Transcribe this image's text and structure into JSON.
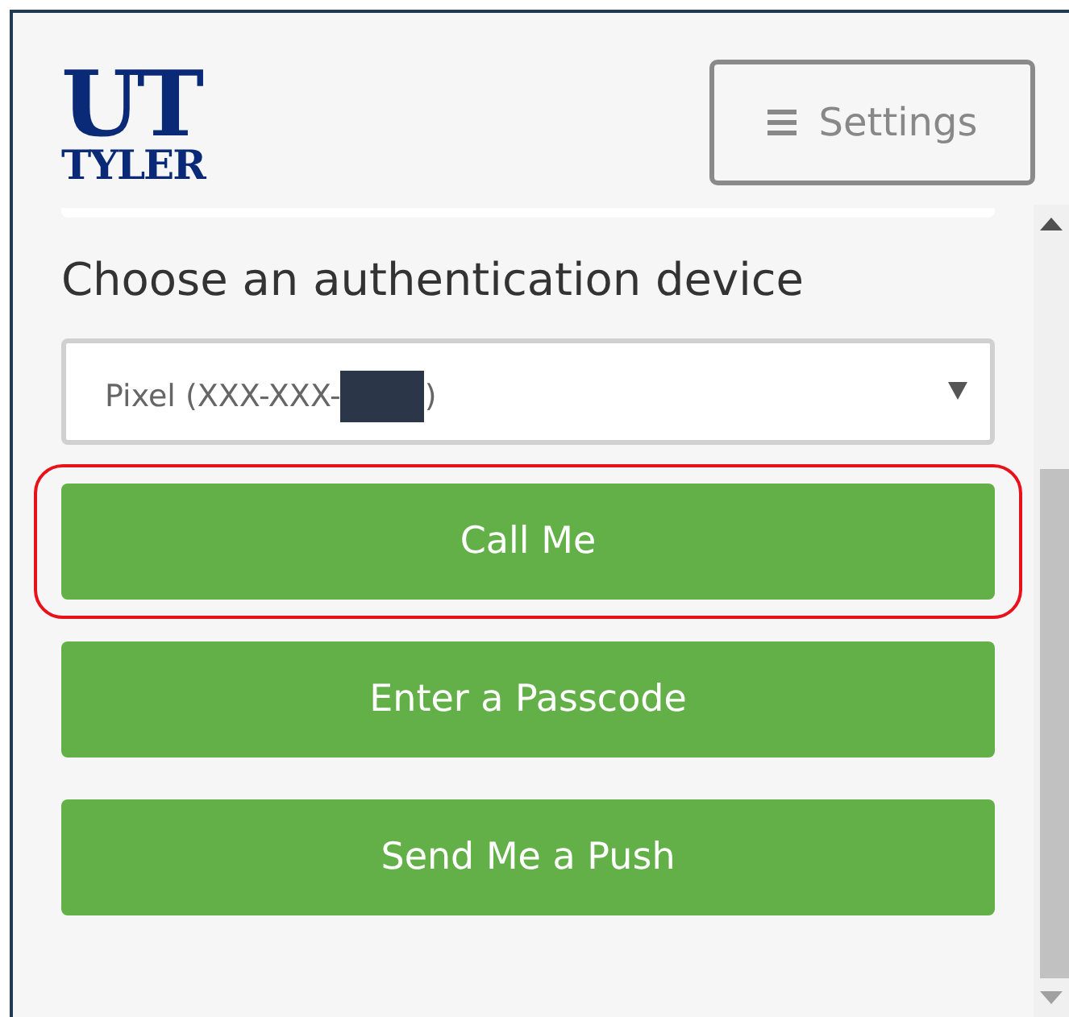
{
  "logo": {
    "line_1": "UT",
    "line_2": "TYLER"
  },
  "settings_button": {
    "label": "Settings"
  },
  "heading": "Choose an authentication device",
  "device_select": {
    "value_start": "Pixel (XXX-XXX-",
    "value_end": ")",
    "redacted": true
  },
  "buttons": [
    {
      "label": "Call Me",
      "highlighted": true
    },
    {
      "label": "Enter a Passcode",
      "highlighted": false
    },
    {
      "label": "Send Me a Push",
      "highlighted": false
    }
  ]
}
